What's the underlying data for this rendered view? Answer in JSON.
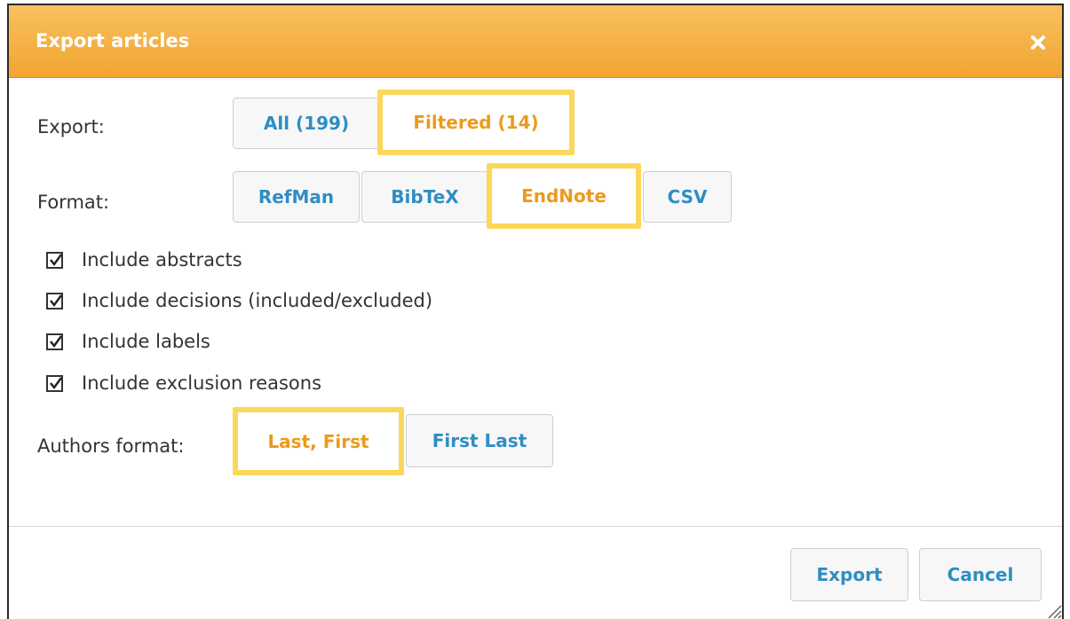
{
  "dialog": {
    "title": "Export articles",
    "close_icon": "close-icon"
  },
  "export": {
    "label": "Export:",
    "options": [
      "All (199)",
      "Filtered (14)"
    ],
    "selected": "Filtered (14)"
  },
  "format": {
    "label": "Format:",
    "options": [
      "RefMan",
      "BibTeX",
      "EndNote",
      "CSV"
    ],
    "selected": "EndNote"
  },
  "checkboxes": [
    {
      "label": "Include abstracts",
      "checked": true
    },
    {
      "label": "Include decisions (included/excluded)",
      "checked": true
    },
    {
      "label": "Include labels",
      "checked": true
    },
    {
      "label": "Include exclusion reasons",
      "checked": true
    }
  ],
  "authors_format": {
    "label": "Authors format:",
    "options": [
      "Last, First",
      "First Last"
    ],
    "selected": "Last, First"
  },
  "footer": {
    "export_label": "Export",
    "cancel_label": "Cancel"
  },
  "colors": {
    "titlebar": "#f5b041",
    "link_blue": "#2e8ec3",
    "active_orange": "#ec9a1c",
    "highlight_yellow": "#fbd75b"
  }
}
